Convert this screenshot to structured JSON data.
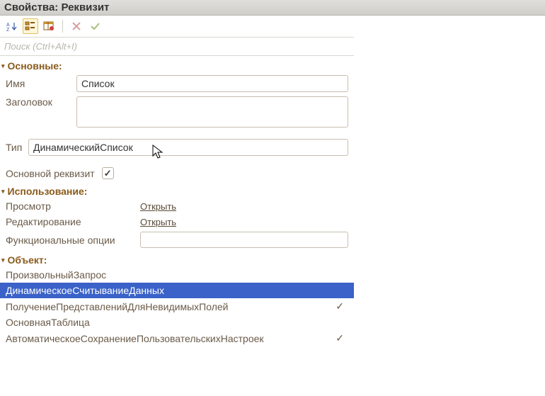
{
  "title": "Свойства: Реквизит",
  "search": {
    "placeholder": "Поиск (Ctrl+Alt+I)"
  },
  "sections": {
    "main_header": "Основные:",
    "usage_header": "Использование:",
    "object_header": "Объект:"
  },
  "main": {
    "name_label": "Имя",
    "name_value": "Список",
    "title_label": "Заголовок",
    "title_value": "",
    "type_label": "Тип",
    "type_value": "ДинамическийСписок",
    "primary_label": "Основной реквизит",
    "primary_checked": "✓"
  },
  "usage": {
    "view_label": "Просмотр",
    "view_link": "Открыть",
    "edit_label": "Редактирование",
    "edit_link": "Открыть",
    "fo_label": "Функциональные опции",
    "fo_value": ""
  },
  "object": {
    "rows": [
      {
        "label": "ПроизвольныйЗапрос",
        "checked": ""
      },
      {
        "label": "ДинамическоеСчитываниеДанных",
        "checked": ""
      },
      {
        "label": "ПолучениеПредставленийДляНевидимыхПолей",
        "checked": "✓"
      },
      {
        "label": "ОсновнаяТаблица",
        "checked": ""
      },
      {
        "label": "АвтоматическоеСохранениеПользовательскихНастроек",
        "checked": "✓"
      }
    ]
  }
}
